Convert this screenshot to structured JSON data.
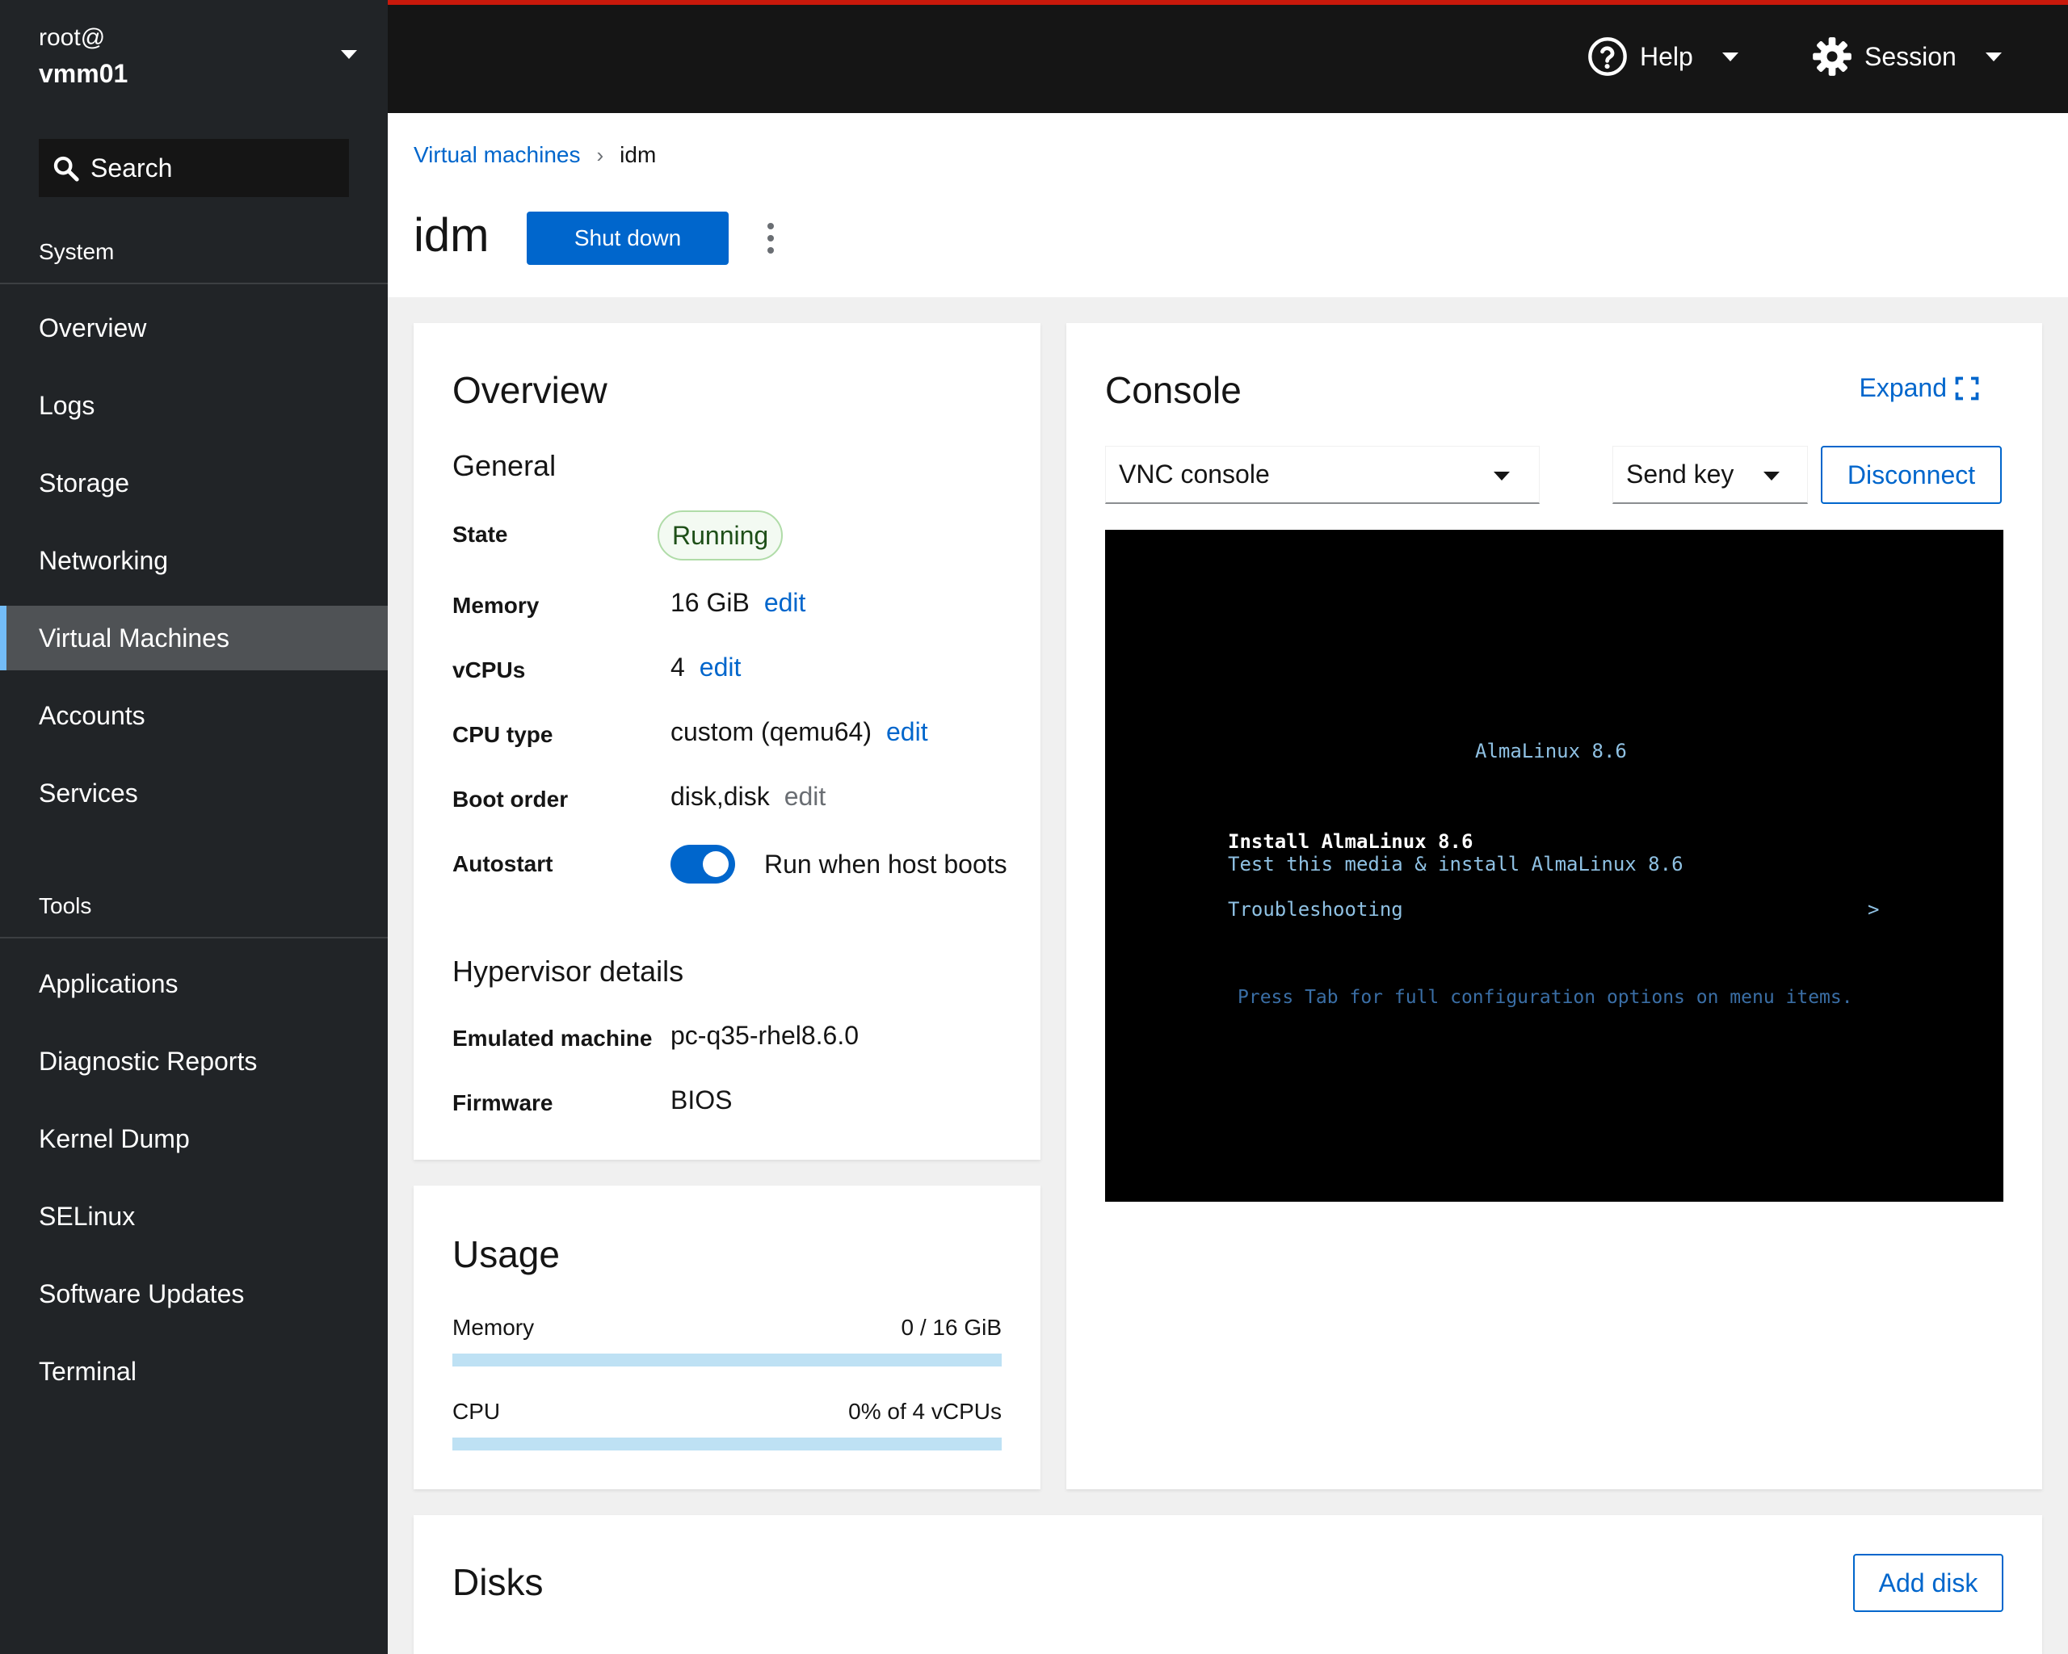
{
  "sidebar": {
    "host_user": "root@",
    "host_name": "vmm01",
    "search_label": "Search",
    "groups": [
      {
        "label": "System",
        "items": [
          {
            "label": "Overview"
          },
          {
            "label": "Logs"
          },
          {
            "label": "Storage"
          },
          {
            "label": "Networking"
          },
          {
            "label": "Virtual Machines",
            "active": true
          },
          {
            "label": "Accounts"
          },
          {
            "label": "Services"
          }
        ]
      },
      {
        "label": "Tools",
        "items": [
          {
            "label": "Applications"
          },
          {
            "label": "Diagnostic Reports"
          },
          {
            "label": "Kernel Dump"
          },
          {
            "label": "SELinux"
          },
          {
            "label": "Software Updates"
          },
          {
            "label": "Terminal"
          }
        ]
      }
    ]
  },
  "topbar": {
    "help_label": "Help",
    "session_label": "Session",
    "accent_color": "#c9190b"
  },
  "page": {
    "breadcrumb_root": "Virtual machines",
    "breadcrumb_current": "idm",
    "vm_name": "idm",
    "shutdown_label": "Shut down"
  },
  "overview": {
    "title": "Overview",
    "general_title": "General",
    "state_label": "State",
    "state_value": "Running",
    "memory_label": "Memory",
    "memory_value": "16 GiB",
    "vcpus_label": "vCPUs",
    "vcpus_value": "4",
    "cputype_label": "CPU type",
    "cputype_value": "custom (qemu64)",
    "bootorder_label": "Boot order",
    "bootorder_value": "disk,disk",
    "autostart_label": "Autostart",
    "autostart_value": "Run when host boots",
    "autostart_on": true,
    "edit_label": "edit",
    "hypervisor_title": "Hypervisor details",
    "emulated_label": "Emulated machine",
    "emulated_value": "pc-q35-rhel8.6.0",
    "firmware_label": "Firmware",
    "firmware_value": "BIOS"
  },
  "usage": {
    "title": "Usage",
    "memory_label": "Memory",
    "memory_value": "0 / 16 GiB",
    "memory_fraction": 0,
    "cpu_label": "CPU",
    "cpu_value": "0% of 4 vCPUs",
    "cpu_fraction": 0
  },
  "console": {
    "title": "Console",
    "expand_label": "Expand",
    "type_selected": "VNC console",
    "sendkey_label": "Send key",
    "disconnect_label": "Disconnect",
    "screen": {
      "heading": "AlmaLinux 8.6",
      "install": "Install AlmaLinux 8.6",
      "test_install": "Test this media & install AlmaLinux 8.6",
      "troubleshooting": "Troubleshooting",
      "submenu_arrow": ">",
      "hint": "Press Tab for full configuration options on menu items."
    }
  },
  "disks": {
    "title": "Disks",
    "add_label": "Add disk"
  },
  "colors": {
    "primary": "#0066cc",
    "sidebar_bg": "#212427",
    "topbar_bg": "#151515",
    "running_green": "#1e4f18"
  }
}
